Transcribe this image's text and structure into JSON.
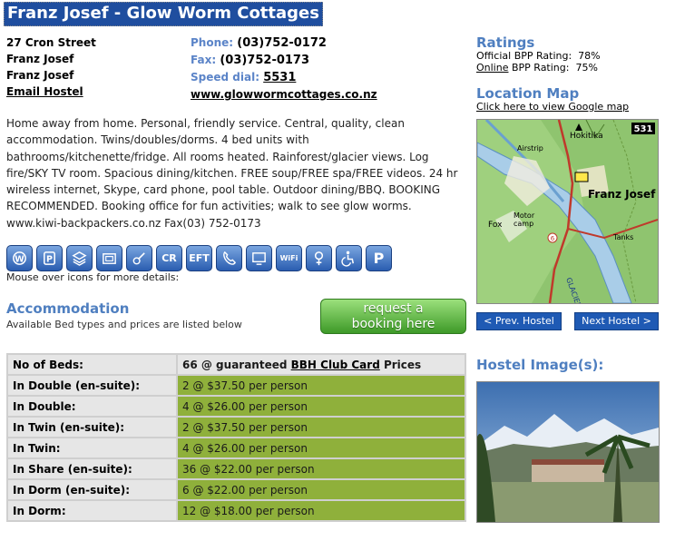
{
  "hostel": {
    "name": "Franz Josef - Glow Worm Cottages",
    "address": [
      "27 Cron Street",
      "Franz Josef",
      "Franz Josef"
    ],
    "email_label": "Email Hostel",
    "phone_label": "Phone:",
    "phone": "(03)752-0172",
    "fax_label": "Fax:",
    "fax": "(03)752-0173",
    "speed_label": "Speed dial:",
    "speed": "5531",
    "website": "www.glowwormcottages.co.nz",
    "description": "Home away from home. Personal, friendly service. Central, quality, clean accommodation. Twins/doubles/dorms. 4 bed units with bathrooms/kitchenette/fridge. All rooms heated. Rainforest/glacier views. Log fire/SKY TV room. Spacious dining/kitchen. FREE soup/FREE spa/FREE videos. 24 hr wireless internet, Skype, card phone, pool table. Outdoor dining/BBQ. BOOKING RECOMMENDED. Booking office for fun activities; walk to see glow worms. www.kiwi-backpackers.co.nz Fax(03) 752-0173"
  },
  "icons": {
    "labels": [
      "",
      "",
      "",
      "",
      "",
      "CR",
      "EFT",
      "",
      "",
      "WiFi",
      "",
      "",
      "P"
    ],
    "hint": "Mouse over icons for more details:"
  },
  "accommodation": {
    "title": "Accommodation",
    "subtitle": "Available Bed types and prices are listed below",
    "book_line1": "request a",
    "book_line2": "booking here",
    "header_key": "No of Beds:",
    "header_value_prefix": "66 @ guaranteed ",
    "header_value_link": "BBH Club Card",
    "header_value_suffix": " Prices",
    "rows": [
      {
        "type": "In Double (en-suite):",
        "price": "2 @ $37.50 per person"
      },
      {
        "type": "In Double:",
        "price": "4 @ $26.00 per person"
      },
      {
        "type": "In Twin (en-suite):",
        "price": "2 @ $37.50 per person"
      },
      {
        "type": "In Twin:",
        "price": "4 @ $26.00 per person"
      },
      {
        "type": "In Share (en-suite):",
        "price": "36 @ $22.00 per person"
      },
      {
        "type": "In Dorm (en-suite):",
        "price": "6 @ $22.00 per person"
      },
      {
        "type": "In Dorm:",
        "price": "12 @ $18.00 per person"
      }
    ]
  },
  "ratings": {
    "title": "Ratings",
    "official_label": "Official BPP Rating:",
    "official_value": "78%",
    "online_link": "Online",
    "online_label": " BPP Rating:",
    "online_value": "75%"
  },
  "map": {
    "title": "Location Map",
    "link": "Click here to view Google map",
    "labels": {
      "badge": "531",
      "hokitika": "Hokitika",
      "airstrip": "Airstrip",
      "town": "Franz Josef",
      "fox": "Fox",
      "motor": "Motor",
      "camp": "camp",
      "tanks": "Tanks",
      "glacier": "GLACIER",
      "road": "6"
    },
    "prev": "< Prev. Hostel",
    "next": "Next Hostel >"
  },
  "images": {
    "title": "Hostel Image(s):"
  }
}
